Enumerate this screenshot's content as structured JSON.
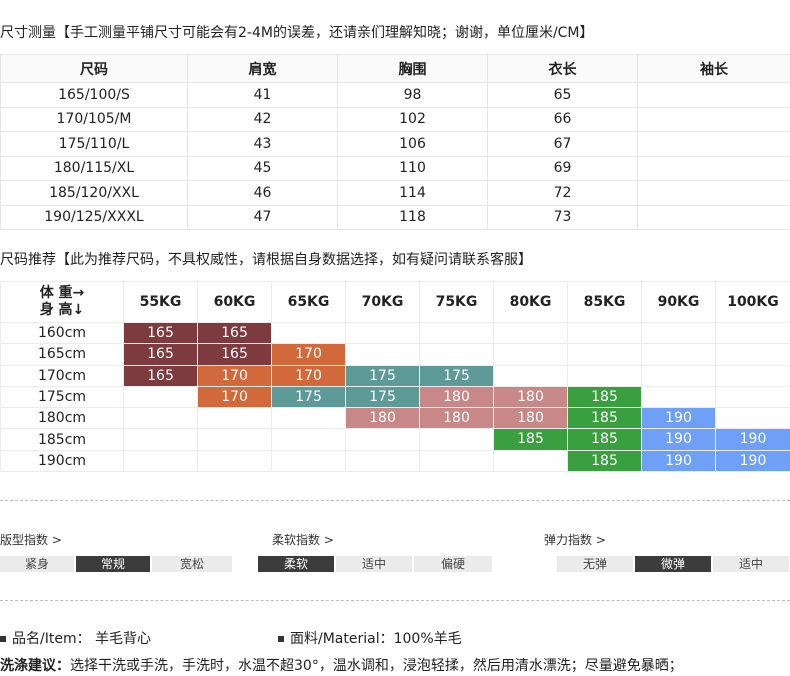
{
  "measure_heading": "尺寸测量【手工测量平铺尺寸可能会有2-4M的误差，还请亲们理解知晓；谢谢，单位厘米/CM】",
  "measure_table": {
    "headers": [
      "尺码",
      "肩宽",
      "胸围",
      "衣长",
      "袖长"
    ],
    "rows": [
      [
        "165/100/S",
        "41",
        "98",
        "65",
        ""
      ],
      [
        "170/105/M",
        "42",
        "102",
        "66",
        ""
      ],
      [
        "175/110/L",
        "43",
        "106",
        "67",
        ""
      ],
      [
        "180/115/XL",
        "45",
        "110",
        "69",
        ""
      ],
      [
        "185/120/XXL",
        "46",
        "114",
        "72",
        ""
      ],
      [
        "190/125/XXXL",
        "47",
        "118",
        "73",
        ""
      ]
    ]
  },
  "rec_heading": "尺码推荐【此为推荐尺码，不具权威性，请根据自身数据选择，如有疑问请联系客服】",
  "rec_table": {
    "corner_line1": "体 重→",
    "corner_line2": "身 高↓",
    "weights": [
      "55KG",
      "60KG",
      "65KG",
      "70KG",
      "75KG",
      "80KG",
      "85KG",
      "90KG",
      "100KG"
    ],
    "heights": [
      "160cm",
      "165cm",
      "170cm",
      "175cm",
      "180cm",
      "185cm",
      "190cm"
    ],
    "cells": [
      [
        "165",
        "165",
        "",
        "",
        "",
        "",
        "",
        "",
        ""
      ],
      [
        "165",
        "165",
        "170",
        "",
        "",
        "",
        "",
        "",
        ""
      ],
      [
        "165",
        "170",
        "170",
        "175",
        "175",
        "",
        "",
        "",
        ""
      ],
      [
        "",
        "170",
        "175",
        "175",
        "180",
        "180",
        "185",
        "",
        ""
      ],
      [
        "",
        "",
        "",
        "180",
        "180",
        "180",
        "185",
        "190",
        ""
      ],
      [
        "",
        "",
        "",
        "",
        "",
        "185",
        "185",
        "190",
        "190"
      ],
      [
        "",
        "",
        "",
        "",
        "",
        "",
        "185",
        "190",
        "190"
      ]
    ],
    "size_colors": {
      "165": "#7d3a3f",
      "170": "#d2693a",
      "175": "#5e9a98",
      "180": "#c98888",
      "185": "#3aa03f",
      "190": "#6ea0f7"
    }
  },
  "indices": {
    "fit": {
      "title": "版型指数 >",
      "options": [
        "紧身",
        "常规",
        "宽松"
      ],
      "selected": 1
    },
    "softness": {
      "title": "柔软指数 >",
      "options": [
        "柔软",
        "适中",
        "偏硬"
      ],
      "selected": 0
    },
    "elasticity": {
      "title": "弹力指数 >",
      "options": [
        "无弹",
        "微弹",
        "适中"
      ],
      "selected": 1
    }
  },
  "product": {
    "item": "品名/Item： 羊毛背心",
    "material": "面料/Material：100%羊毛"
  },
  "wash": {
    "label": "洗涤建议：",
    "text": "选择干洗或手洗，手洗时，水温不超30°，温水调和，浸泡轻揉，然后用清水漂洗；尽量避免暴晒；"
  }
}
